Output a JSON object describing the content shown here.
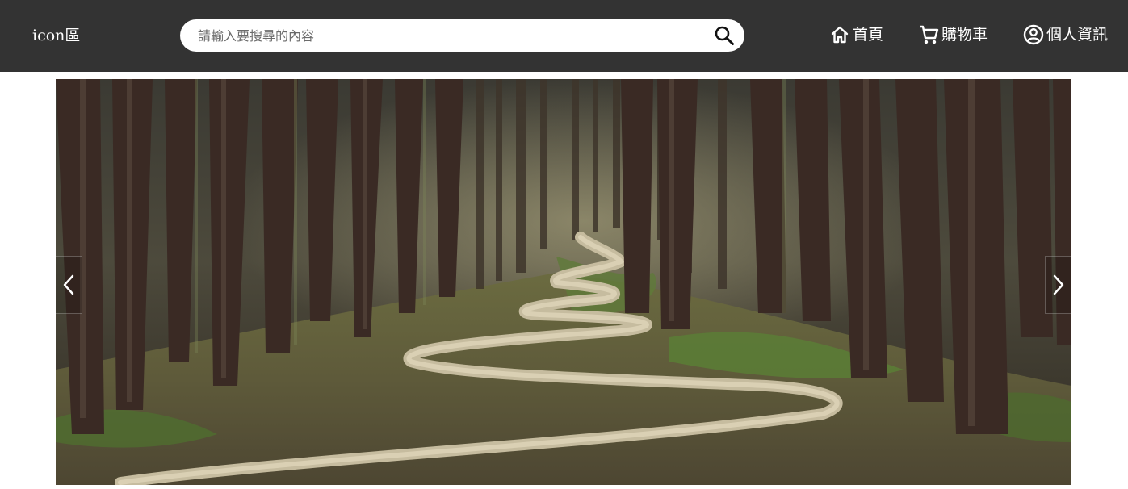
{
  "brand": {
    "label": "icon區"
  },
  "search": {
    "placeholder": "請輸入要搜尋的內容",
    "value": ""
  },
  "nav": {
    "home_label": "首頁",
    "cart_label": "購物車",
    "profile_label": "個人資訊"
  },
  "carousel": {
    "image_icon": "forest-path-photo",
    "prev_icon": "chevron-left-icon",
    "next_icon": "chevron-right-icon"
  },
  "colors": {
    "navbar_bg": "#333333",
    "text": "#ffffff",
    "search_bg": "#ffffff"
  }
}
